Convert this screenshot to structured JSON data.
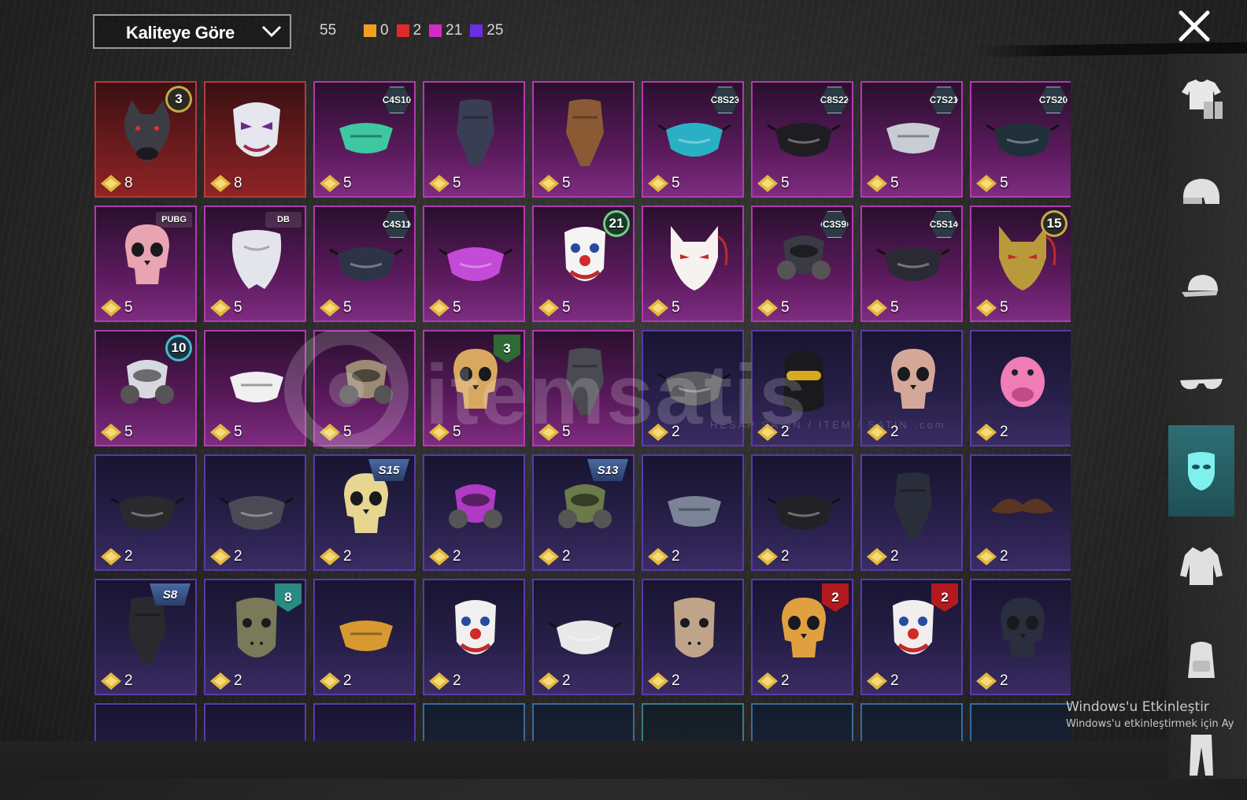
{
  "sort": {
    "label": "Kaliteye Göre"
  },
  "summary": {
    "total": "55",
    "legend": [
      {
        "color": "#f0a020",
        "count": "0"
      },
      {
        "color": "#e02a2a",
        "count": "2"
      },
      {
        "color": "#d22cc8",
        "count": "21"
      },
      {
        "color": "#6a2ee0",
        "count": "25"
      }
    ]
  },
  "categories": [
    {
      "name": "outfit-icon",
      "active": false
    },
    {
      "name": "helmet-icon",
      "active": false
    },
    {
      "name": "cap-icon",
      "active": false
    },
    {
      "name": "glasses-icon",
      "active": false
    },
    {
      "name": "mask-icon",
      "active": true
    },
    {
      "name": "jacket-icon",
      "active": false
    },
    {
      "name": "backpack-icon",
      "active": false
    },
    {
      "name": "pants-icon",
      "active": false
    }
  ],
  "items": [
    {
      "quality": "red",
      "price": "8",
      "badge": {
        "type": "circle-gold",
        "text": "3"
      },
      "art": "wolf-mask",
      "color": "#3c3c44"
    },
    {
      "quality": "red",
      "price": "8",
      "badge": null,
      "art": "joker-mask",
      "color": "#e6e6ee"
    },
    {
      "quality": "pink",
      "price": "5",
      "badge": {
        "type": "hex",
        "text": "C4S10"
      },
      "art": "half-mask",
      "color": "#3ec7a0"
    },
    {
      "quality": "pink",
      "price": "5",
      "badge": null,
      "art": "bandana",
      "color": "#3a3e54"
    },
    {
      "quality": "pink",
      "price": "5",
      "badge": null,
      "art": "bandana",
      "color": "#8a5a34"
    },
    {
      "quality": "pink",
      "price": "5",
      "badge": {
        "type": "hex",
        "text": "C8S23"
      },
      "art": "face-mask",
      "color": "#2ab0c4"
    },
    {
      "quality": "pink",
      "price": "5",
      "badge": {
        "type": "hex",
        "text": "C8S22"
      },
      "art": "face-mask",
      "color": "#1e1e22"
    },
    {
      "quality": "pink",
      "price": "5",
      "badge": {
        "type": "hex",
        "text": "C7S21"
      },
      "art": "half-mask",
      "color": "#c8ccd4"
    },
    {
      "quality": "pink",
      "price": "5",
      "badge": {
        "type": "hex",
        "text": "C7S20"
      },
      "art": "face-mask",
      "color": "#20303a"
    },
    {
      "quality": "pink",
      "price": "5",
      "badge": {
        "type": "logo",
        "text": "PUBG"
      },
      "art": "skull",
      "color": "#e8a4b0"
    },
    {
      "quality": "pink",
      "price": "5",
      "badge": {
        "type": "logo",
        "text": "DB"
      },
      "art": "beard",
      "color": "#e4e4ec"
    },
    {
      "quality": "pink",
      "price": "5",
      "badge": {
        "type": "hex",
        "text": "C4S11"
      },
      "art": "face-mask",
      "color": "#2e3448"
    },
    {
      "quality": "pink",
      "price": "5",
      "badge": null,
      "art": "face-mask",
      "color": "#c44ad8"
    },
    {
      "quality": "pink",
      "price": "5",
      "badge": {
        "type": "circle-green",
        "text": "21"
      },
      "art": "clown",
      "color": "#f4f4f4"
    },
    {
      "quality": "pink",
      "price": "5",
      "badge": null,
      "art": "fox-mask",
      "color": "#f6f2f0"
    },
    {
      "quality": "pink",
      "price": "5",
      "badge": {
        "type": "hex",
        "text": "C3S9"
      },
      "art": "gas-mask",
      "color": "#3a3a44"
    },
    {
      "quality": "pink",
      "price": "5",
      "badge": {
        "type": "hex",
        "text": "C5S14"
      },
      "art": "face-mask",
      "color": "#2a2a34"
    },
    {
      "quality": "pink",
      "price": "5",
      "badge": {
        "type": "circle-gold",
        "text": "15"
      },
      "art": "fox-mask",
      "color": "#b89a3a"
    },
    {
      "quality": "pink",
      "price": "5",
      "badge": {
        "type": "circle-teal",
        "text": "10"
      },
      "art": "gas-mask",
      "color": "#d8d8e0"
    },
    {
      "quality": "pink",
      "price": "5",
      "badge": null,
      "art": "half-mask",
      "color": "#f0f0f0"
    },
    {
      "quality": "pink",
      "price": "5",
      "badge": null,
      "art": "gas-mask",
      "color": "#9c8a74"
    },
    {
      "quality": "pink",
      "price": "5",
      "badge": {
        "type": "shield-green",
        "text": "3"
      },
      "art": "skull",
      "color": "#d8a860"
    },
    {
      "quality": "pink",
      "price": "5",
      "badge": null,
      "art": "bandana",
      "color": "#4a4a52"
    },
    {
      "quality": "purple",
      "price": "2",
      "badge": null,
      "art": "face-mask",
      "color": "#5a5a60"
    },
    {
      "quality": "purple",
      "price": "2",
      "badge": null,
      "art": "balaclava",
      "color": "#1a1a1e"
    },
    {
      "quality": "purple",
      "price": "2",
      "badge": null,
      "art": "skull",
      "color": "#d4a898"
    },
    {
      "quality": "purple",
      "price": "2",
      "badge": null,
      "art": "pig",
      "color": "#f07cb8"
    },
    {
      "quality": "purple",
      "price": "2",
      "badge": null,
      "art": "face-mask",
      "color": "#2a2a2e"
    },
    {
      "quality": "purple",
      "price": "2",
      "badge": null,
      "art": "face-mask",
      "color": "#4a4a54"
    },
    {
      "quality": "purple",
      "price": "2",
      "badge": {
        "type": "season",
        "text": "S15"
      },
      "art": "skull",
      "color": "#e6d690"
    },
    {
      "quality": "purple",
      "price": "2",
      "badge": null,
      "art": "gas-mask",
      "color": "#b03ac4"
    },
    {
      "quality": "purple",
      "price": "2",
      "badge": {
        "type": "season",
        "text": "S13"
      },
      "art": "gas-mask",
      "color": "#6a7a4a"
    },
    {
      "quality": "purple",
      "price": "2",
      "badge": null,
      "art": "half-mask",
      "color": "#7a8496"
    },
    {
      "quality": "purple",
      "price": "2",
      "badge": null,
      "art": "face-mask",
      "color": "#222226"
    },
    {
      "quality": "purple",
      "price": "2",
      "badge": null,
      "art": "bandana",
      "color": "#2a2e3a"
    },
    {
      "quality": "purple",
      "price": "2",
      "badge": null,
      "art": "mustache",
      "color": "#5a3622"
    },
    {
      "quality": "purple",
      "price": "2",
      "badge": {
        "type": "season",
        "text": "S8"
      },
      "art": "bandana",
      "color": "#2a2a2e"
    },
    {
      "quality": "purple",
      "price": "2",
      "badge": {
        "type": "shield-teal",
        "text": "8"
      },
      "art": "hockey",
      "color": "#7a7a5a"
    },
    {
      "quality": "purple",
      "price": "2",
      "badge": null,
      "art": "half-mask",
      "color": "#d89a30"
    },
    {
      "quality": "purple",
      "price": "2",
      "badge": null,
      "art": "clown",
      "color": "#f0f0f0"
    },
    {
      "quality": "purple",
      "price": "2",
      "badge": null,
      "art": "face-mask",
      "color": "#e8e8e8"
    },
    {
      "quality": "purple",
      "price": "2",
      "badge": null,
      "art": "hockey",
      "color": "#c0a48a"
    },
    {
      "quality": "purple",
      "price": "2",
      "badge": {
        "type": "shield-red",
        "text": "2"
      },
      "art": "skull",
      "color": "#e0a040"
    },
    {
      "quality": "purple",
      "price": "2",
      "badge": {
        "type": "shield-red",
        "text": "2"
      },
      "art": "clown",
      "color": "#f2eeee"
    },
    {
      "quality": "purple",
      "price": "2",
      "badge": null,
      "art": "skull",
      "color": "#2a2e3e"
    },
    {
      "quality": "purple",
      "price": "",
      "badge": null,
      "art": "partial",
      "color": "#555"
    },
    {
      "quality": "purple",
      "price": "",
      "badge": null,
      "art": "partial",
      "color": "#333"
    },
    {
      "quality": "purple",
      "price": "",
      "badge": null,
      "art": "partial",
      "color": "#444"
    },
    {
      "quality": "blue",
      "price": "",
      "badge": null,
      "art": "partial",
      "color": "#8a8a7a"
    },
    {
      "quality": "blue",
      "price": "",
      "badge": null,
      "art": "partial",
      "color": "#c8d040"
    },
    {
      "quality": "teal",
      "price": "",
      "badge": null,
      "art": "partial",
      "color": "#3a8a4a"
    },
    {
      "quality": "blue",
      "price": "",
      "badge": null,
      "art": "partial",
      "color": "#8a5ab0"
    },
    {
      "quality": "blue",
      "price": "",
      "badge": null,
      "art": "partial",
      "color": "#d07a8a"
    },
    {
      "quality": "blue",
      "price": "",
      "badge": null,
      "art": "partial",
      "color": "#444"
    }
  ],
  "watermark": {
    "text": "itemsatis",
    "sub": "HESAP SATIN / ITEM / SATIN .com"
  },
  "windows": {
    "title": "Windows'u Etkinleştir",
    "subtitle": "Windows'u etkinleştirmek için Ay"
  }
}
